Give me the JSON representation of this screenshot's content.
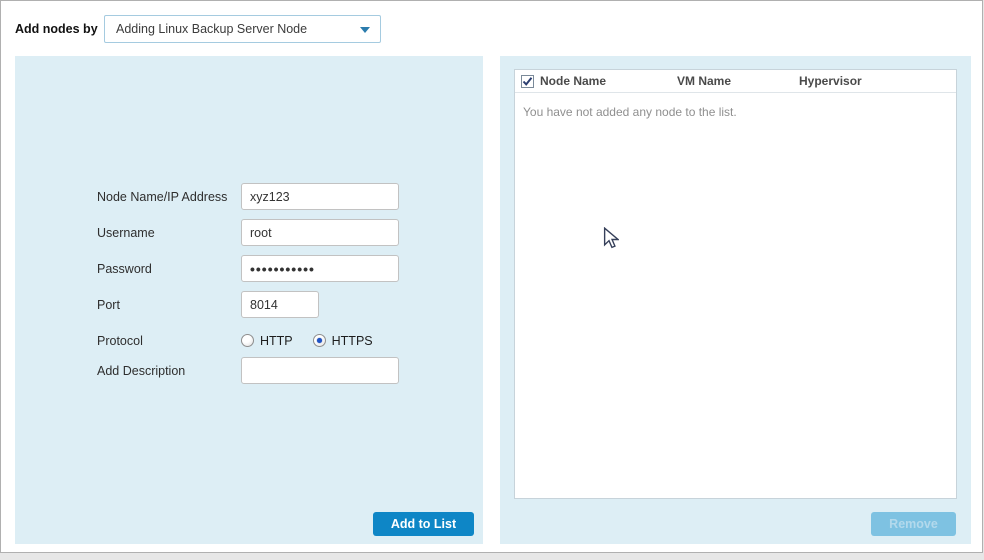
{
  "header": {
    "label": "Add nodes by",
    "dropdown": {
      "value": "Adding Linux Backup Server Node"
    }
  },
  "form": {
    "node_name": {
      "label": "Node Name/IP Address",
      "value": "xyz123"
    },
    "username": {
      "label": "Username",
      "value": "root"
    },
    "password": {
      "label": "Password",
      "masked_value": "•••••••••••"
    },
    "port": {
      "label": "Port",
      "value": "8014"
    },
    "protocol": {
      "label": "Protocol",
      "options": [
        "HTTP",
        "HTTPS"
      ],
      "selected": "HTTPS"
    },
    "description": {
      "label": "Add Description",
      "value": "",
      "placeholder": ""
    },
    "add_button_label": "Add to List"
  },
  "node_table": {
    "select_all_checked": true,
    "headers": [
      "Node Name",
      "VM Name",
      "Hypervisor"
    ],
    "rows": [],
    "empty_message": "You have not added any node to the list.",
    "remove_button_label": "Remove",
    "remove_enabled": false
  },
  "colors": {
    "accent": "#0e86c6",
    "panel_background": "#ddeef5",
    "disabled_button": "#7ec2e2",
    "dropdown_border": "#a5cbe0"
  }
}
